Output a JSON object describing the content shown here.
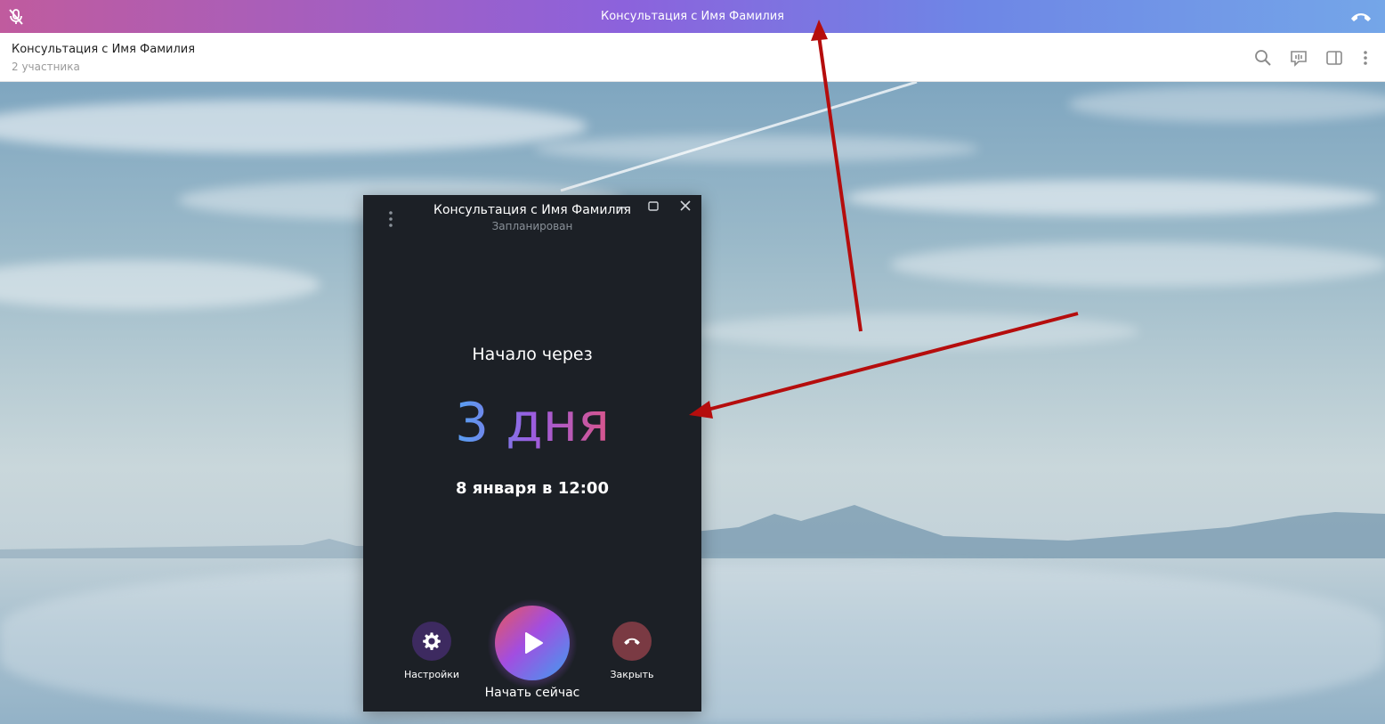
{
  "call_bar": {
    "title": "Консультация с Имя Фамилия",
    "icons": [
      "mic-off-icon",
      "hangup-icon"
    ]
  },
  "chat_header": {
    "title": "Консультация с Имя Фамилия",
    "subtitle": "2 участника",
    "icons": [
      "search-icon",
      "voice-chat-icon",
      "sidebar-toggle-icon",
      "more-vertical-icon"
    ]
  },
  "call_window": {
    "title": "Консультация с Имя Фамилия",
    "status": "Запланирован",
    "starts_in_label": "Начало через",
    "countdown": "3 дня",
    "date": "8 января в 12:00",
    "buttons": {
      "settings": "Настройки",
      "start_now": "Начать сейчас",
      "close": "Закрыть"
    }
  },
  "colors": {
    "call_bar_gradient": [
      "#c05b9e",
      "#8c62dc",
      "#74a6e8"
    ],
    "window_bg": "#1c2026",
    "settings_button": "#3d2a60",
    "close_button": "#7a3a43",
    "annotation_arrow": "#b50d0d"
  }
}
